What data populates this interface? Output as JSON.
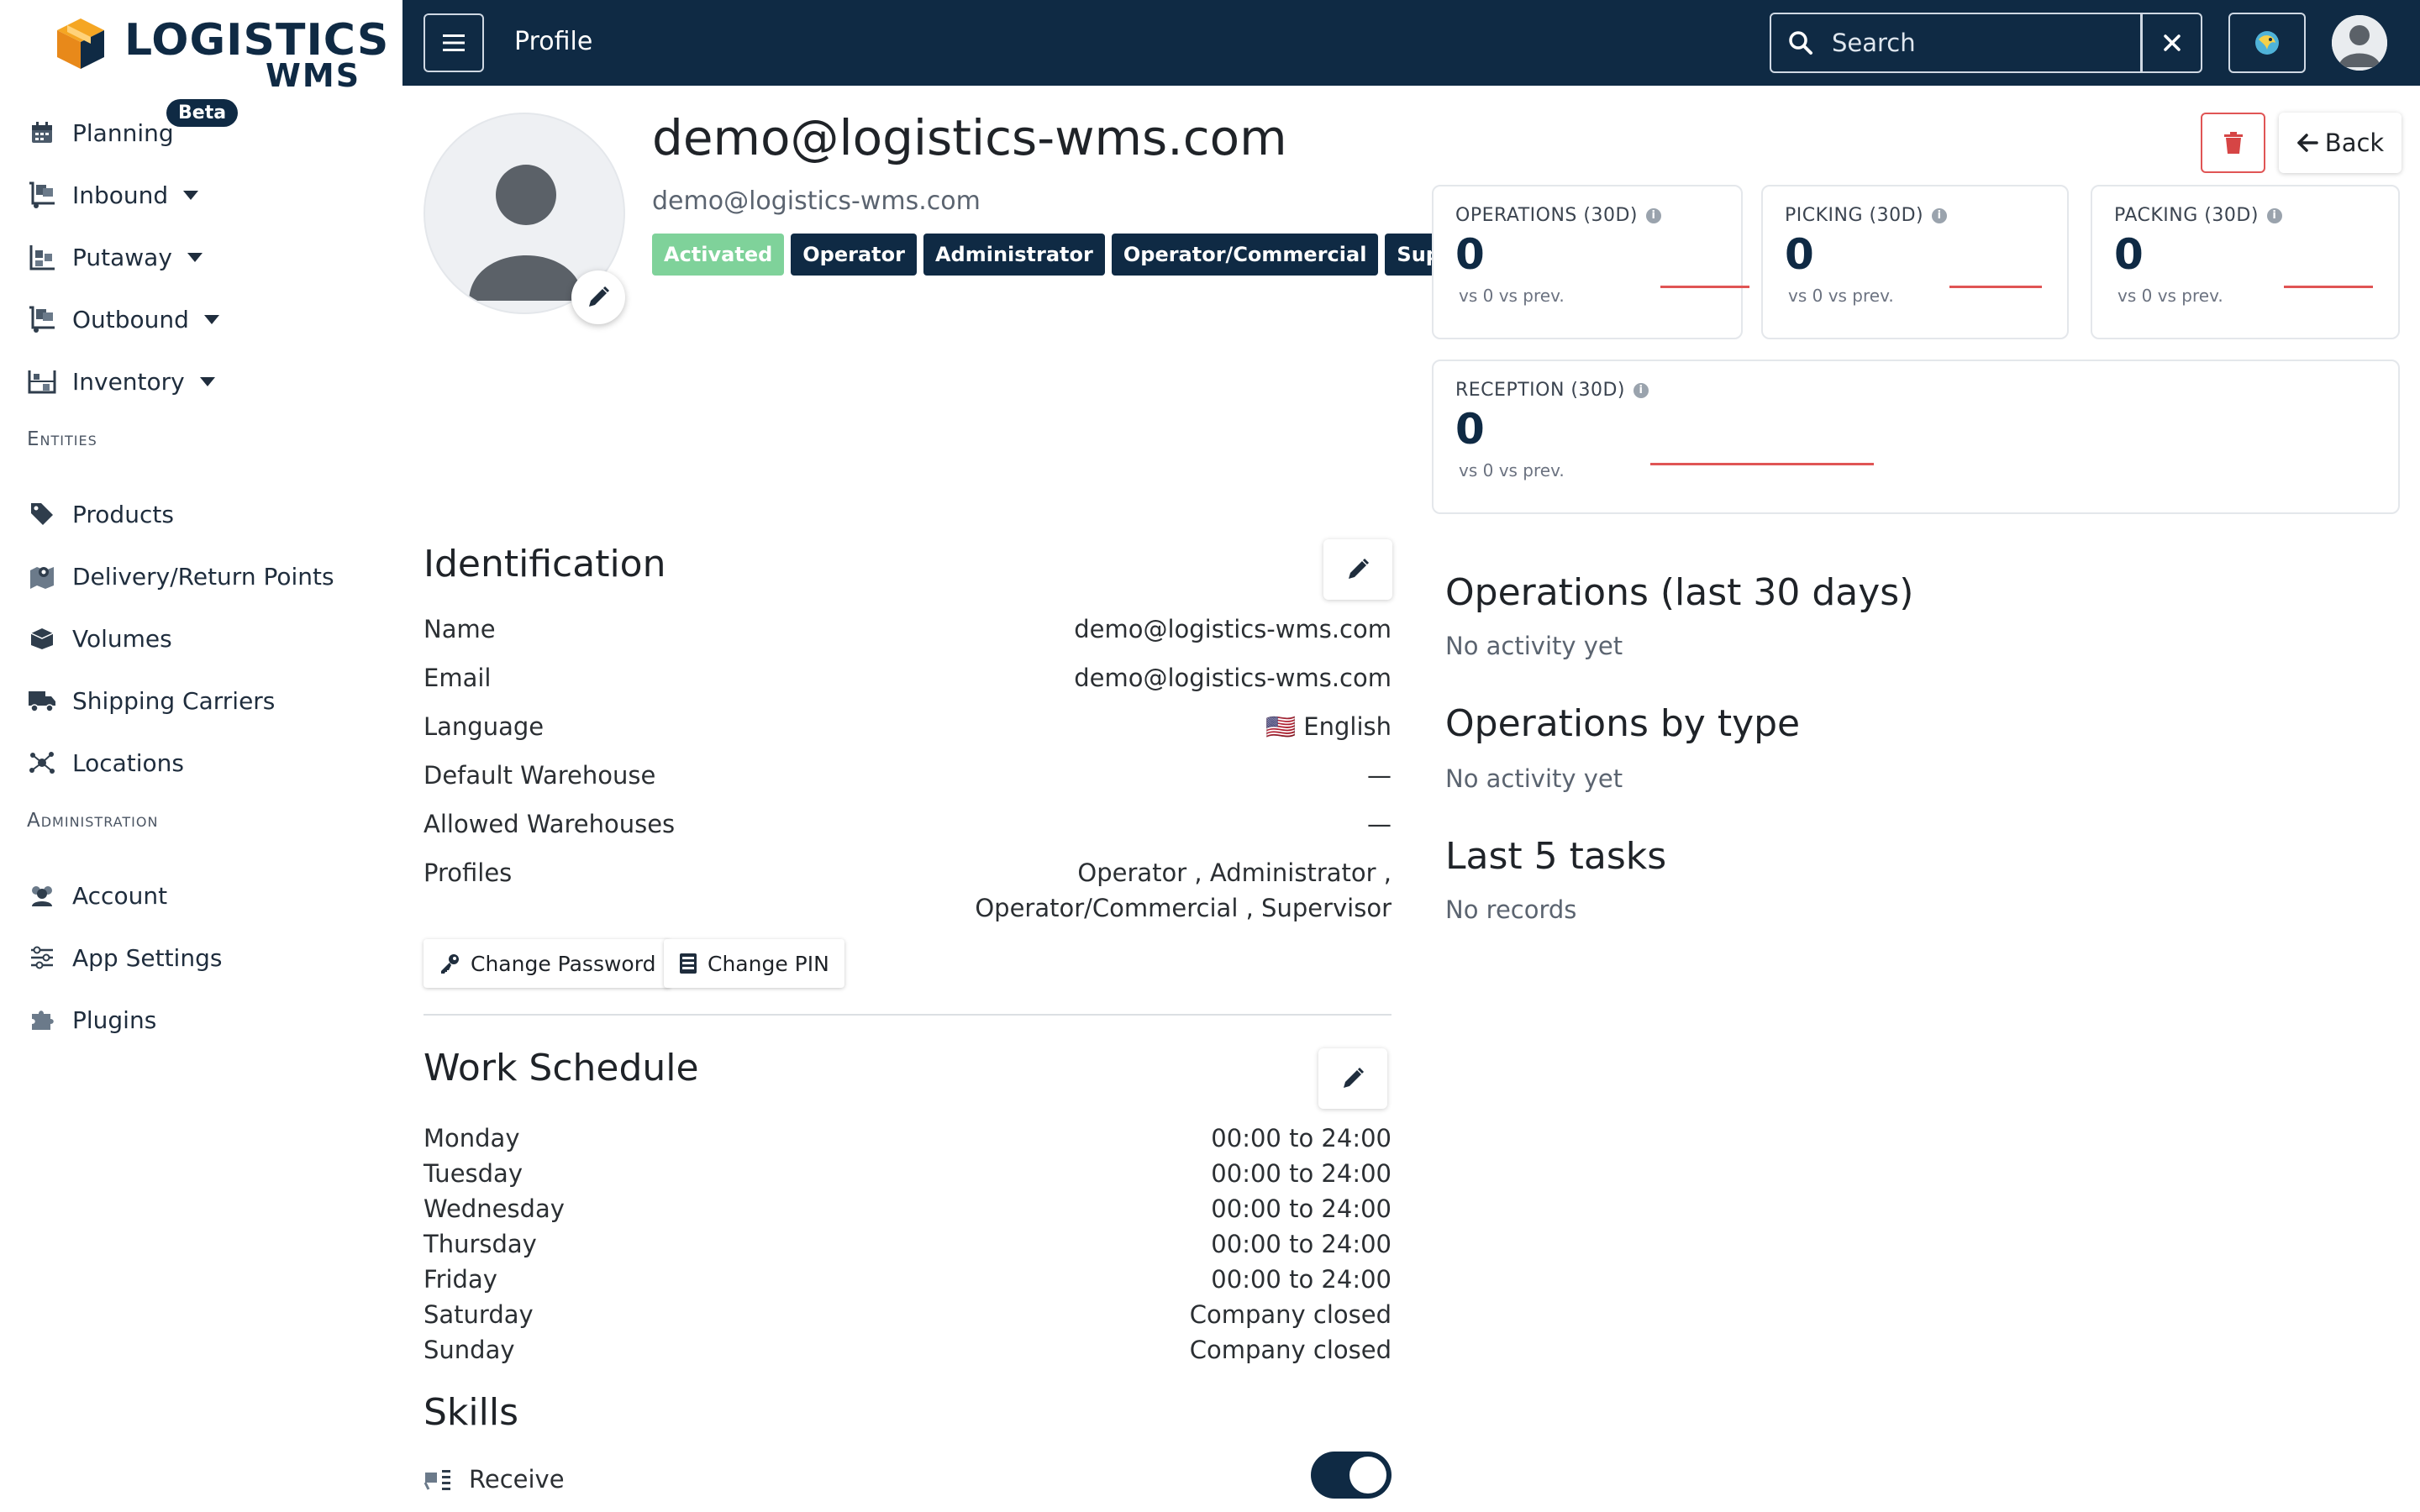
{
  "brand": {
    "name": "LOGISTICS",
    "sub": "WMS"
  },
  "sidebar": {
    "items": [
      {
        "label": "Planning",
        "icon": "calendar-icon",
        "badge": "Beta"
      },
      {
        "label": "Inbound",
        "icon": "inbound-icon"
      },
      {
        "label": "Putaway",
        "icon": "putaway-icon"
      },
      {
        "label": "Outbound",
        "icon": "outbound-icon"
      },
      {
        "label": "Inventory",
        "icon": "inventory-icon"
      }
    ],
    "entities_title": "Entities",
    "entities": [
      {
        "label": "Products",
        "icon": "tag-icon"
      },
      {
        "label": "Delivery/Return Points",
        "icon": "map-pin-icon"
      },
      {
        "label": "Volumes",
        "icon": "box-icon"
      },
      {
        "label": "Shipping Carriers",
        "icon": "truck-icon"
      },
      {
        "label": "Locations",
        "icon": "network-icon"
      }
    ],
    "administration_title": "Administration",
    "administration": [
      {
        "label": "Account",
        "icon": "users-icon"
      },
      {
        "label": "App Settings",
        "icon": "sliders-icon"
      },
      {
        "label": "Plugins",
        "icon": "puzzle-icon"
      }
    ]
  },
  "topbar": {
    "title": "Profile",
    "search_placeholder": "Search"
  },
  "profile": {
    "name": "demo@logistics-wms.com",
    "email": "demo@logistics-wms.com",
    "status": "Activated",
    "roles": [
      "Operator",
      "Administrator",
      "Operator/Commercial",
      "Supervisor"
    ],
    "back_label": "Back"
  },
  "stats": [
    {
      "title": "OPERATIONS (30D)",
      "value": "0",
      "sub": "vs 0 vs prev."
    },
    {
      "title": "PICKING (30D)",
      "value": "0",
      "sub": "vs 0 vs prev."
    },
    {
      "title": "PACKING (30D)",
      "value": "0",
      "sub": "vs 0 vs prev."
    },
    {
      "title": "RECEPTION (30D)",
      "value": "0",
      "sub": "vs 0 vs prev."
    }
  ],
  "identification": {
    "title": "Identification",
    "rows": [
      {
        "label": "Name",
        "value": "demo@logistics-wms.com"
      },
      {
        "label": "Email",
        "value": "demo@logistics-wms.com"
      },
      {
        "label": "Language",
        "value": "English",
        "flag": "🇺🇸"
      },
      {
        "label": "Default Warehouse",
        "value": "—"
      },
      {
        "label": "Allowed Warehouses",
        "value": "—"
      },
      {
        "label": "Profiles",
        "value_line1": "Operator , Administrator ,",
        "value_line2": "Operator/Commercial , Supervisor"
      }
    ],
    "change_password": "Change Password",
    "change_pin": "Change PIN"
  },
  "schedule": {
    "title": "Work Schedule",
    "days": [
      {
        "day": "Monday",
        "hours": "00:00 to 24:00"
      },
      {
        "day": "Tuesday",
        "hours": "00:00 to 24:00"
      },
      {
        "day": "Wednesday",
        "hours": "00:00 to 24:00"
      },
      {
        "day": "Thursday",
        "hours": "00:00 to 24:00"
      },
      {
        "day": "Friday",
        "hours": "00:00 to 24:00"
      },
      {
        "day": "Saturday",
        "hours": "Company closed"
      },
      {
        "day": "Sunday",
        "hours": "Company closed"
      }
    ]
  },
  "skills": {
    "title": "Skills",
    "items": [
      {
        "label": "Receive",
        "enabled": true
      }
    ]
  },
  "activity": {
    "ops_title": "Operations (last 30 days)",
    "ops_empty": "No activity yet",
    "type_title": "Operations by type",
    "type_empty": "No activity yet",
    "tasks_title": "Last 5 tasks",
    "tasks_empty": "No records"
  },
  "colors": {
    "navy": "#0f2a44",
    "green": "#7fd29a",
    "danger": "#e05555",
    "orange": "#f39c12"
  }
}
